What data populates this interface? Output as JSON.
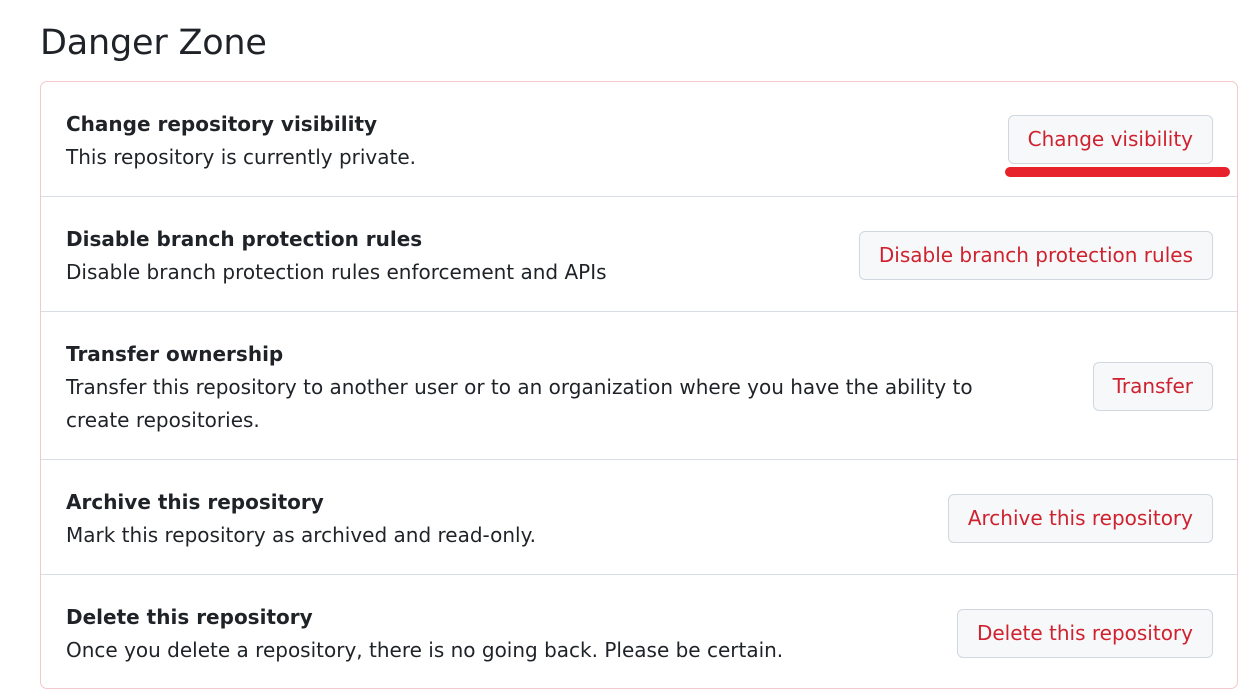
{
  "page": {
    "heading": "Danger Zone"
  },
  "rows": [
    {
      "title": "Change repository visibility",
      "description": "This repository is currently private.",
      "button_label": "Change visibility"
    },
    {
      "title": "Disable branch protection rules",
      "description": "Disable branch protection rules enforcement and APIs",
      "button_label": "Disable branch protection rules"
    },
    {
      "title": "Transfer ownership",
      "description": "Transfer this repository to another user or to an organization where you have the ability to create repositories.",
      "button_label": "Transfer"
    },
    {
      "title": "Archive this repository",
      "description": "Mark this repository as archived and read-only.",
      "button_label": "Archive this repository"
    },
    {
      "title": "Delete this repository",
      "description": "Once you delete a repository, there is no going back. Please be certain.",
      "button_label": "Delete this repository"
    }
  ],
  "colors": {
    "danger_text": "#cf222e",
    "danger_border": "#f4c9cc",
    "button_bg": "#f6f8fa",
    "annotation": "#e8222a"
  }
}
